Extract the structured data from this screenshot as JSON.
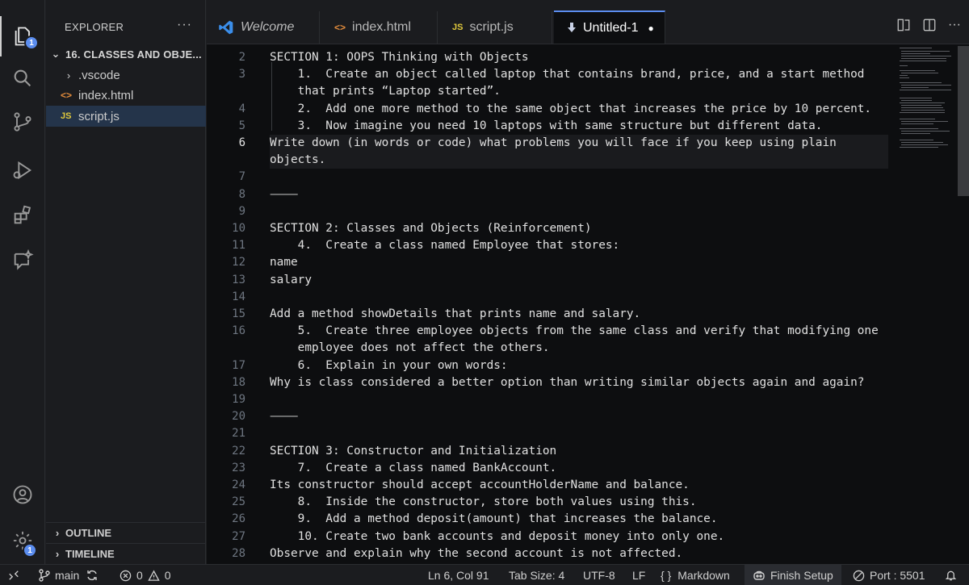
{
  "activity": {
    "explorer_badge": "1",
    "accounts_badge": "1"
  },
  "sidebar": {
    "title": "EXPLORER",
    "more": "···",
    "folder": "16. CLASSES AND OBJE...",
    "items": [
      {
        "label": ".vscode",
        "icon": "chevron-right-icon"
      },
      {
        "label": "index.html",
        "icon": "html-file-icon"
      },
      {
        "label": "script.js",
        "icon": "js-file-icon"
      }
    ],
    "outline": "OUTLINE",
    "timeline": "TIMELINE"
  },
  "tabs": [
    {
      "label": "Welcome",
      "icon": "vscode-logo-icon"
    },
    {
      "label": "index.html",
      "icon": "html-file-icon"
    },
    {
      "label": "script.js",
      "icon": "js-file-icon"
    },
    {
      "label": "Untitled-1",
      "icon": "download-arrow-icon",
      "dirty": "●"
    }
  ],
  "tab_actions": {
    "more": "···"
  },
  "icon_labels": {
    "html": "<>",
    "js": "JS"
  },
  "editor": {
    "current_line": "6",
    "lines": [
      {
        "n": "2",
        "text": "SECTION 1: OOPS Thinking with Objects"
      },
      {
        "n": "3",
        "text": "    1.  Create an object called laptop that contains brand, price, and a start method"
      },
      {
        "n": "",
        "text": "    that prints “Laptop started”."
      },
      {
        "n": "4",
        "text": "    2.  Add one more method to the same object that increases the price by 10 percent."
      },
      {
        "n": "5",
        "text": "    3.  Now imagine you need 10 laptops with same structure but different data."
      },
      {
        "n": "6",
        "text": "Write down (in words or code) what problems you will face if you keep using plain"
      },
      {
        "n": "",
        "text": "objects."
      },
      {
        "n": "7",
        "text": ""
      },
      {
        "n": "8",
        "text": "⸻"
      },
      {
        "n": "9",
        "text": ""
      },
      {
        "n": "10",
        "text": "SECTION 2: Classes and Objects (Reinforcement)"
      },
      {
        "n": "11",
        "text": "    4.  Create a class named Employee that stores:"
      },
      {
        "n": "12",
        "text": "name"
      },
      {
        "n": "13",
        "text": "salary"
      },
      {
        "n": "14",
        "text": ""
      },
      {
        "n": "15",
        "text": "Add a method showDetails that prints name and salary."
      },
      {
        "n": "16",
        "text": "    5.  Create three employee objects from the same class and verify that modifying one"
      },
      {
        "n": "",
        "text": "    employee does not affect the others."
      },
      {
        "n": "17",
        "text": "    6.  Explain in your own words:"
      },
      {
        "n": "18",
        "text": "Why is class considered a better option than writing similar objects again and again?"
      },
      {
        "n": "19",
        "text": ""
      },
      {
        "n": "20",
        "text": "⸻"
      },
      {
        "n": "21",
        "text": ""
      },
      {
        "n": "22",
        "text": "SECTION 3: Constructor and Initialization"
      },
      {
        "n": "23",
        "text": "    7.  Create a class named BankAccount."
      },
      {
        "n": "24",
        "text": "Its constructor should accept accountHolderName and balance."
      },
      {
        "n": "25",
        "text": "    8.  Inside the constructor, store both values using this."
      },
      {
        "n": "26",
        "text": "    9.  Add a method deposit(amount) that increases the balance."
      },
      {
        "n": "27",
        "text": "    10. Create two bank accounts and deposit money into only one."
      },
      {
        "n": "28",
        "text": "Observe and explain why the second account is not affected."
      }
    ]
  },
  "status": {
    "branch": "main",
    "errors": "0",
    "warnings": "0",
    "position": "Ln 6, Col 91",
    "tab_size": "Tab Size: 4",
    "encoding": "UTF-8",
    "eol": "LF",
    "language": "Markdown",
    "language_icon": "{ }",
    "setup": "Finish Setup",
    "port": "Port : 5501"
  }
}
